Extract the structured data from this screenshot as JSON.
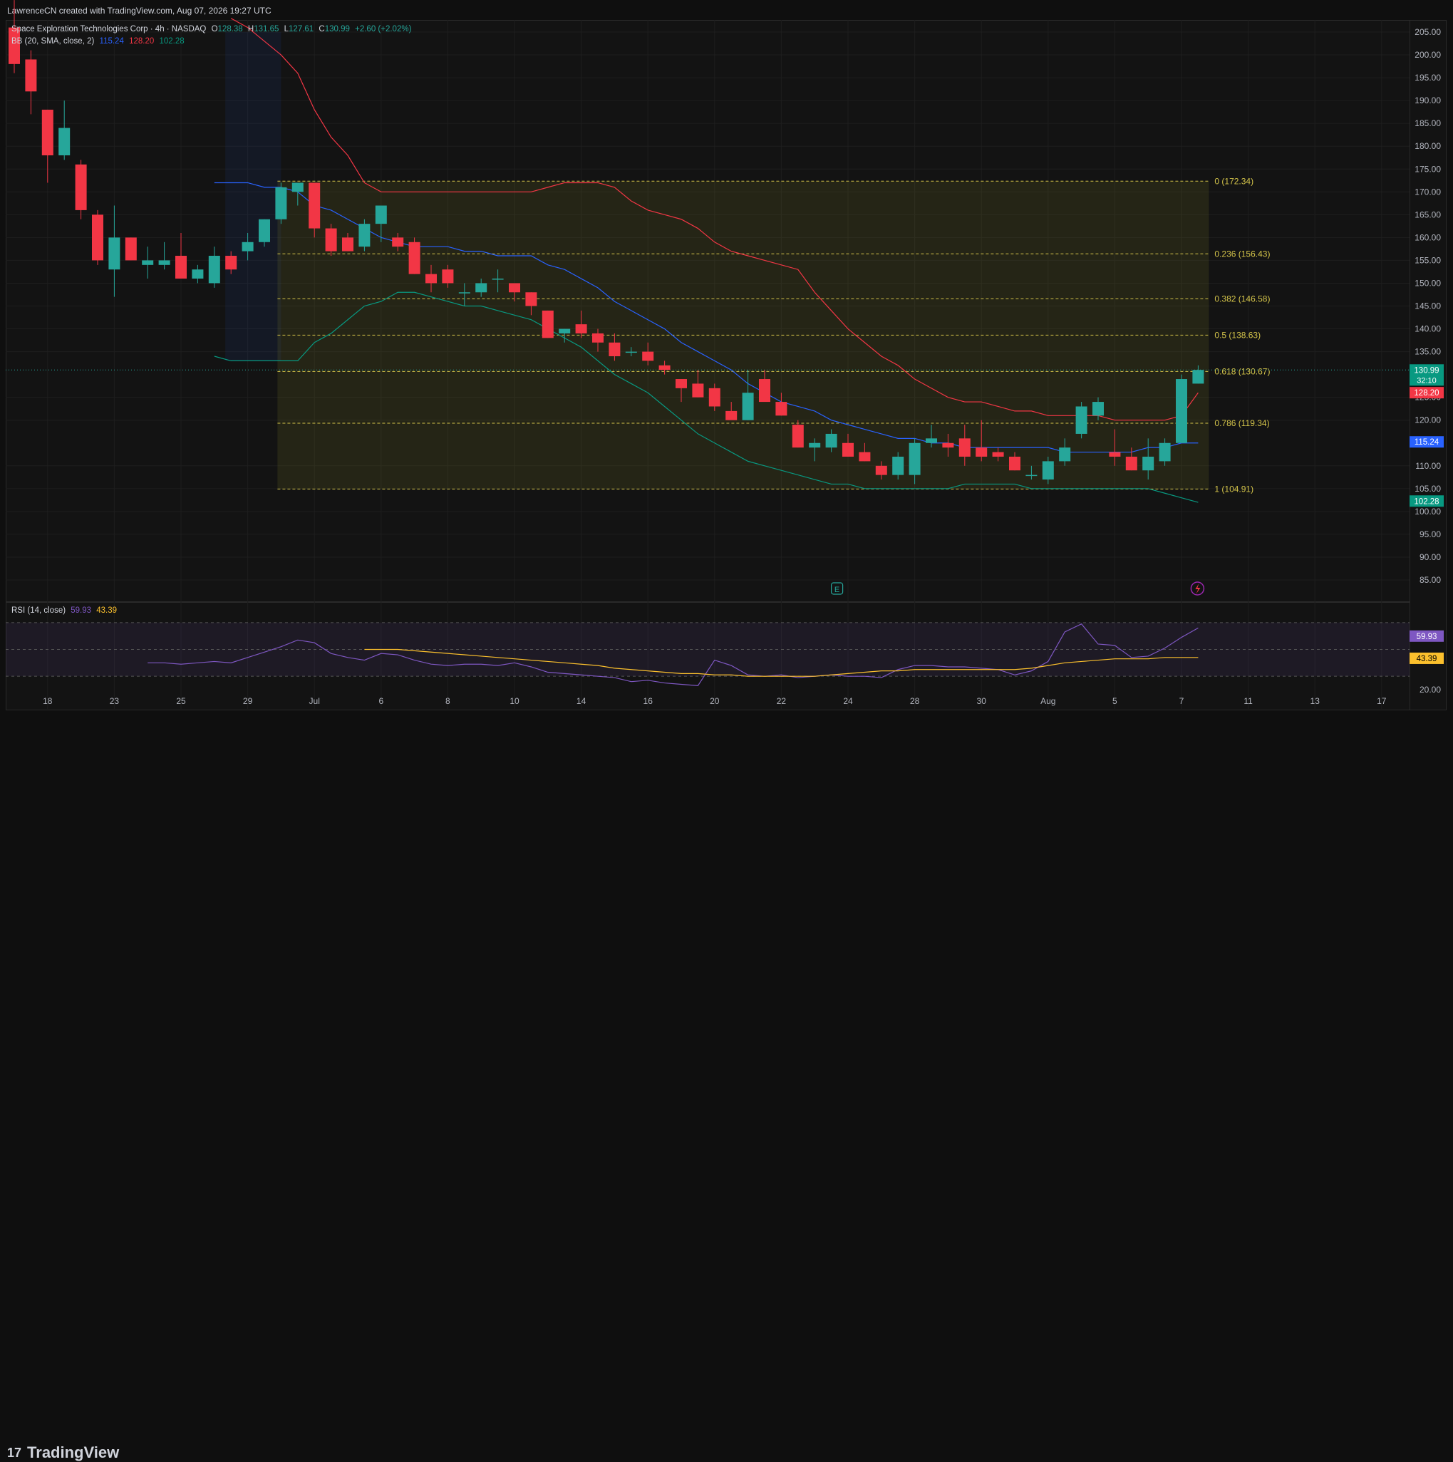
{
  "watermark": "LawrenceCN created with TradingView.com, Aug 07, 2026 19:27 UTC",
  "legend": {
    "symbol": "Space Exploration Technologies Corp · 4h · NASDAQ",
    "o_label": "O",
    "o": "128.38",
    "h_label": "H",
    "h": "131.65",
    "l_label": "L",
    "l": "127.61",
    "c_label": "C",
    "c": "130.99",
    "change": "+2.60 (+2.02%)",
    "bb_label": "BB (20, SMA, close, 2)",
    "bb_mid": "115.24",
    "bb_upper": "128.20",
    "bb_lower": "102.28",
    "rsi_label": "RSI (14, close)",
    "rsi_val": "59.93",
    "rsi_ma": "43.39"
  },
  "price_badges": {
    "last": "130.99",
    "countdown": "32:10",
    "upper": "128.20",
    "mid": "115.24",
    "lower": "102.28",
    "rsi": "59.93",
    "rsi_ma": "43.39"
  },
  "brand": "TradingView",
  "colors": {
    "up": "#26a69a",
    "down": "#f23645",
    "bb_upper": "#f23645",
    "bb_mid": "#2962ff",
    "bb_lower": "#089981",
    "fib": "#d4c44a",
    "rsi": "#7e57c2",
    "rsi_ma": "#fbc02d",
    "fib_fill": "rgba(120,123,40,0.18)"
  },
  "chart_data": [
    {
      "type": "candlestick",
      "title": "Space Exploration Technologies Corp · 4h · NASDAQ",
      "y_axis_ticks": [
        "205.00",
        "200.00",
        "195.00",
        "190.00",
        "185.00",
        "180.00",
        "175.00",
        "170.00",
        "165.00",
        "160.00",
        "155.00",
        "150.00",
        "145.00",
        "140.00",
        "135.00",
        "125.00",
        "120.00",
        "110.00",
        "105.00",
        "100.00",
        "95.00",
        "90.00",
        "85.00"
      ],
      "ylim": [
        81,
        207
      ],
      "x_axis_ticks": [
        {
          "label": "18",
          "bar": 2
        },
        {
          "label": "23",
          "bar": 6
        },
        {
          "label": "25",
          "bar": 10
        },
        {
          "label": "29",
          "bar": 14
        },
        {
          "label": "Jul",
          "bar": 18
        },
        {
          "label": "6",
          "bar": 22
        },
        {
          "label": "8",
          "bar": 26
        },
        {
          "label": "10",
          "bar": 30
        },
        {
          "label": "14",
          "bar": 34
        },
        {
          "label": "16",
          "bar": 38
        },
        {
          "label": "20",
          "bar": 42
        },
        {
          "label": "22",
          "bar": 46
        },
        {
          "label": "24",
          "bar": 50
        },
        {
          "label": "28",
          "bar": 54
        },
        {
          "label": "30",
          "bar": 58
        },
        {
          "label": "Aug",
          "bar": 62
        },
        {
          "label": "5",
          "bar": 66
        },
        {
          "label": "7",
          "bar": 70
        },
        {
          "label": "11",
          "bar": 74
        },
        {
          "label": "13",
          "bar": 78
        },
        {
          "label": "17",
          "bar": 82
        }
      ],
      "candles": [
        [
          206,
          212,
          196,
          198
        ],
        [
          199,
          201,
          187,
          192
        ],
        [
          188,
          188,
          172,
          178
        ],
        [
          178,
          190,
          177,
          184
        ],
        [
          176,
          177,
          164,
          166
        ],
        [
          165,
          166,
          154,
          155
        ],
        [
          153,
          167,
          147,
          160
        ],
        [
          160,
          160,
          155,
          155
        ],
        [
          154,
          158,
          151,
          155
        ],
        [
          154,
          159,
          153,
          155
        ],
        [
          156,
          161,
          151,
          151
        ],
        [
          151,
          154,
          150,
          153
        ],
        [
          150,
          158,
          149,
          156
        ],
        [
          156,
          157,
          152,
          153
        ],
        [
          157,
          161,
          155,
          159
        ],
        [
          159,
          164,
          158,
          164
        ],
        [
          164,
          172,
          163,
          171
        ],
        [
          170,
          172,
          167,
          172
        ],
        [
          172,
          172,
          160,
          162
        ],
        [
          162,
          163,
          156,
          157
        ],
        [
          160,
          161,
          157,
          157
        ],
        [
          158,
          164,
          157,
          163
        ],
        [
          163,
          167,
          159,
          167
        ],
        [
          160,
          161,
          157,
          158
        ],
        [
          159,
          160,
          152,
          152
        ],
        [
          152,
          154,
          148,
          150
        ],
        [
          153,
          154,
          149,
          150
        ],
        [
          148,
          150,
          145,
          148
        ],
        [
          148,
          151,
          147,
          150
        ],
        [
          151,
          153,
          148,
          151
        ],
        [
          150,
          150,
          146,
          148
        ],
        [
          148,
          148,
          143,
          145
        ],
        [
          144,
          144,
          138,
          138
        ],
        [
          139,
          140,
          137,
          140
        ],
        [
          141,
          144,
          138,
          139
        ],
        [
          139,
          140,
          135,
          137
        ],
        [
          137,
          139,
          133,
          134
        ],
        [
          135,
          136,
          134,
          135
        ],
        [
          135,
          137,
          132,
          133
        ],
        [
          132,
          133,
          130,
          131
        ],
        [
          129,
          129,
          124,
          127
        ],
        [
          128,
          131,
          125,
          125
        ],
        [
          127,
          128,
          122,
          123
        ],
        [
          122,
          124,
          121,
          120
        ],
        [
          120,
          131,
          120,
          126
        ],
        [
          129,
          131,
          125,
          124
        ],
        [
          124,
          126,
          121,
          121
        ],
        [
          119,
          120,
          114,
          114
        ],
        [
          114,
          116,
          111,
          115
        ],
        [
          114,
          118,
          113,
          117
        ],
        [
          115,
          117,
          112,
          112
        ],
        [
          113,
          115,
          111,
          111
        ],
        [
          110,
          111,
          107,
          108
        ],
        [
          108,
          113,
          107,
          112
        ],
        [
          108,
          116,
          106,
          115
        ],
        [
          115,
          119,
          114,
          116
        ],
        [
          115,
          117,
          112,
          114
        ],
        [
          116,
          119,
          110,
          112
        ],
        [
          114,
          120,
          111,
          112
        ],
        [
          113,
          114,
          111,
          112
        ],
        [
          112,
          113,
          109,
          109
        ],
        [
          108,
          110,
          107,
          108
        ],
        [
          107,
          112,
          106,
          111
        ],
        [
          111,
          116,
          110,
          114
        ],
        [
          117,
          124,
          116,
          123
        ],
        [
          121,
          125,
          120,
          124
        ],
        [
          113,
          118,
          110,
          112
        ],
        [
          112,
          114,
          109,
          109
        ],
        [
          109,
          116,
          107,
          112
        ],
        [
          111,
          116,
          110,
          115
        ],
        [
          115,
          130,
          115,
          129
        ],
        [
          128,
          132,
          128,
          131
        ]
      ],
      "bollinger": {
        "upper": [
          null,
          null,
          null,
          null,
          null,
          null,
          null,
          null,
          null,
          null,
          null,
          null,
          null,
          208,
          206,
          203,
          200,
          196,
          188,
          182,
          178,
          172,
          170,
          170,
          170,
          170,
          170,
          170,
          170,
          170,
          170,
          170,
          171,
          172,
          172,
          172,
          171,
          168,
          166,
          165,
          164,
          162,
          159,
          157,
          156,
          155,
          154,
          153,
          148,
          144,
          140,
          137,
          134,
          132,
          129,
          127,
          125,
          124,
          124,
          123,
          122,
          122,
          121,
          121,
          121,
          121,
          120,
          120,
          120,
          120,
          121,
          126
        ],
        "middle": [
          null,
          null,
          null,
          null,
          null,
          null,
          null,
          null,
          null,
          null,
          null,
          null,
          172,
          172,
          172,
          171,
          171,
          170,
          167,
          166,
          164,
          162,
          160,
          159,
          158,
          158,
          158,
          157,
          157,
          156,
          156,
          156,
          154,
          153,
          151,
          149,
          146,
          144,
          142,
          140,
          137,
          135,
          133,
          131,
          128,
          126,
          124,
          123,
          122,
          120,
          119,
          118,
          117,
          116,
          116,
          115,
          115,
          114,
          114,
          114,
          114,
          114,
          114,
          113,
          113,
          113,
          113,
          113,
          114,
          114,
          115,
          115
        ],
        "lower": [
          null,
          null,
          null,
          null,
          null,
          null,
          null,
          null,
          null,
          null,
          null,
          null,
          134,
          133,
          133,
          133,
          133,
          133,
          137,
          139,
          142,
          145,
          146,
          148,
          148,
          147,
          146,
          145,
          145,
          144,
          143,
          142,
          140,
          138,
          136,
          133,
          130,
          128,
          126,
          123,
          120,
          117,
          115,
          113,
          111,
          110,
          109,
          108,
          107,
          106,
          106,
          105,
          105,
          105,
          105,
          105,
          105,
          106,
          106,
          106,
          106,
          105,
          105,
          105,
          105,
          105,
          105,
          105,
          105,
          104,
          103,
          102
        ]
      }
    },
    {
      "type": "line",
      "title": "RSI (14, close)",
      "bands": [
        70,
        50,
        30
      ],
      "ylim": [
        20,
        80
      ],
      "x": [
        8,
        9,
        10,
        11,
        12,
        13,
        14,
        15,
        16,
        17,
        18,
        19,
        20,
        21,
        22,
        23,
        24,
        25,
        26,
        27,
        28,
        29,
        30,
        31,
        32,
        33,
        34,
        35,
        36,
        37,
        38,
        39,
        40,
        41,
        42,
        43,
        44,
        45,
        46,
        47,
        48,
        49,
        50,
        51,
        52,
        53,
        54,
        55,
        56,
        57,
        58,
        59,
        60,
        61,
        62,
        63,
        64,
        65,
        66,
        67,
        68,
        69,
        70,
        71
      ],
      "series": [
        {
          "name": "RSI",
          "values": [
            40,
            40,
            39,
            40,
            41,
            40,
            44,
            48,
            52,
            57,
            55,
            47,
            44,
            42,
            47,
            46,
            42,
            39,
            38,
            39,
            39,
            38,
            40,
            37,
            33,
            32,
            31,
            30,
            29,
            26,
            27,
            25,
            24,
            23,
            42,
            38,
            31,
            30,
            31,
            29,
            30,
            31,
            30,
            30,
            29,
            35,
            38,
            38,
            37,
            37,
            36,
            35,
            31,
            34,
            41,
            63,
            69,
            54,
            53,
            44,
            45,
            51,
            59,
            66
          ]
        },
        {
          "name": "RSI-based MA",
          "values": [
            null,
            null,
            null,
            null,
            null,
            null,
            null,
            null,
            null,
            null,
            null,
            null,
            null,
            50,
            50,
            50,
            49,
            48,
            47,
            46,
            45,
            44,
            43,
            42,
            41,
            40,
            39,
            38,
            36,
            35,
            34,
            33,
            32,
            32,
            31,
            31,
            30,
            30,
            30,
            30,
            30,
            31,
            32,
            33,
            34,
            34,
            35,
            35,
            35,
            35,
            35,
            35,
            35,
            36,
            38,
            40,
            41,
            42,
            43,
            43,
            43,
            44,
            44,
            44
          ]
        }
      ]
    }
  ],
  "fib_levels": [
    {
      "ratio": "0",
      "value": 172.34,
      "label": "0 (172.34)"
    },
    {
      "ratio": "0.236",
      "value": 156.43,
      "label": "0.236 (156.43)"
    },
    {
      "ratio": "0.382",
      "value": 146.58,
      "label": "0.382 (146.58)"
    },
    {
      "ratio": "0.5",
      "value": 138.63,
      "label": "0.5 (138.63)"
    },
    {
      "ratio": "0.618",
      "value": 130.67,
      "label": "0.618 (130.67)"
    },
    {
      "ratio": "0.786",
      "value": 119.34,
      "label": "0.786 (119.34)"
    },
    {
      "ratio": "1",
      "value": 104.91,
      "label": "1 (104.91)"
    }
  ],
  "rsi_axis": {
    "bottom_tick": "20.00"
  },
  "markers": {
    "earnings": "E"
  }
}
